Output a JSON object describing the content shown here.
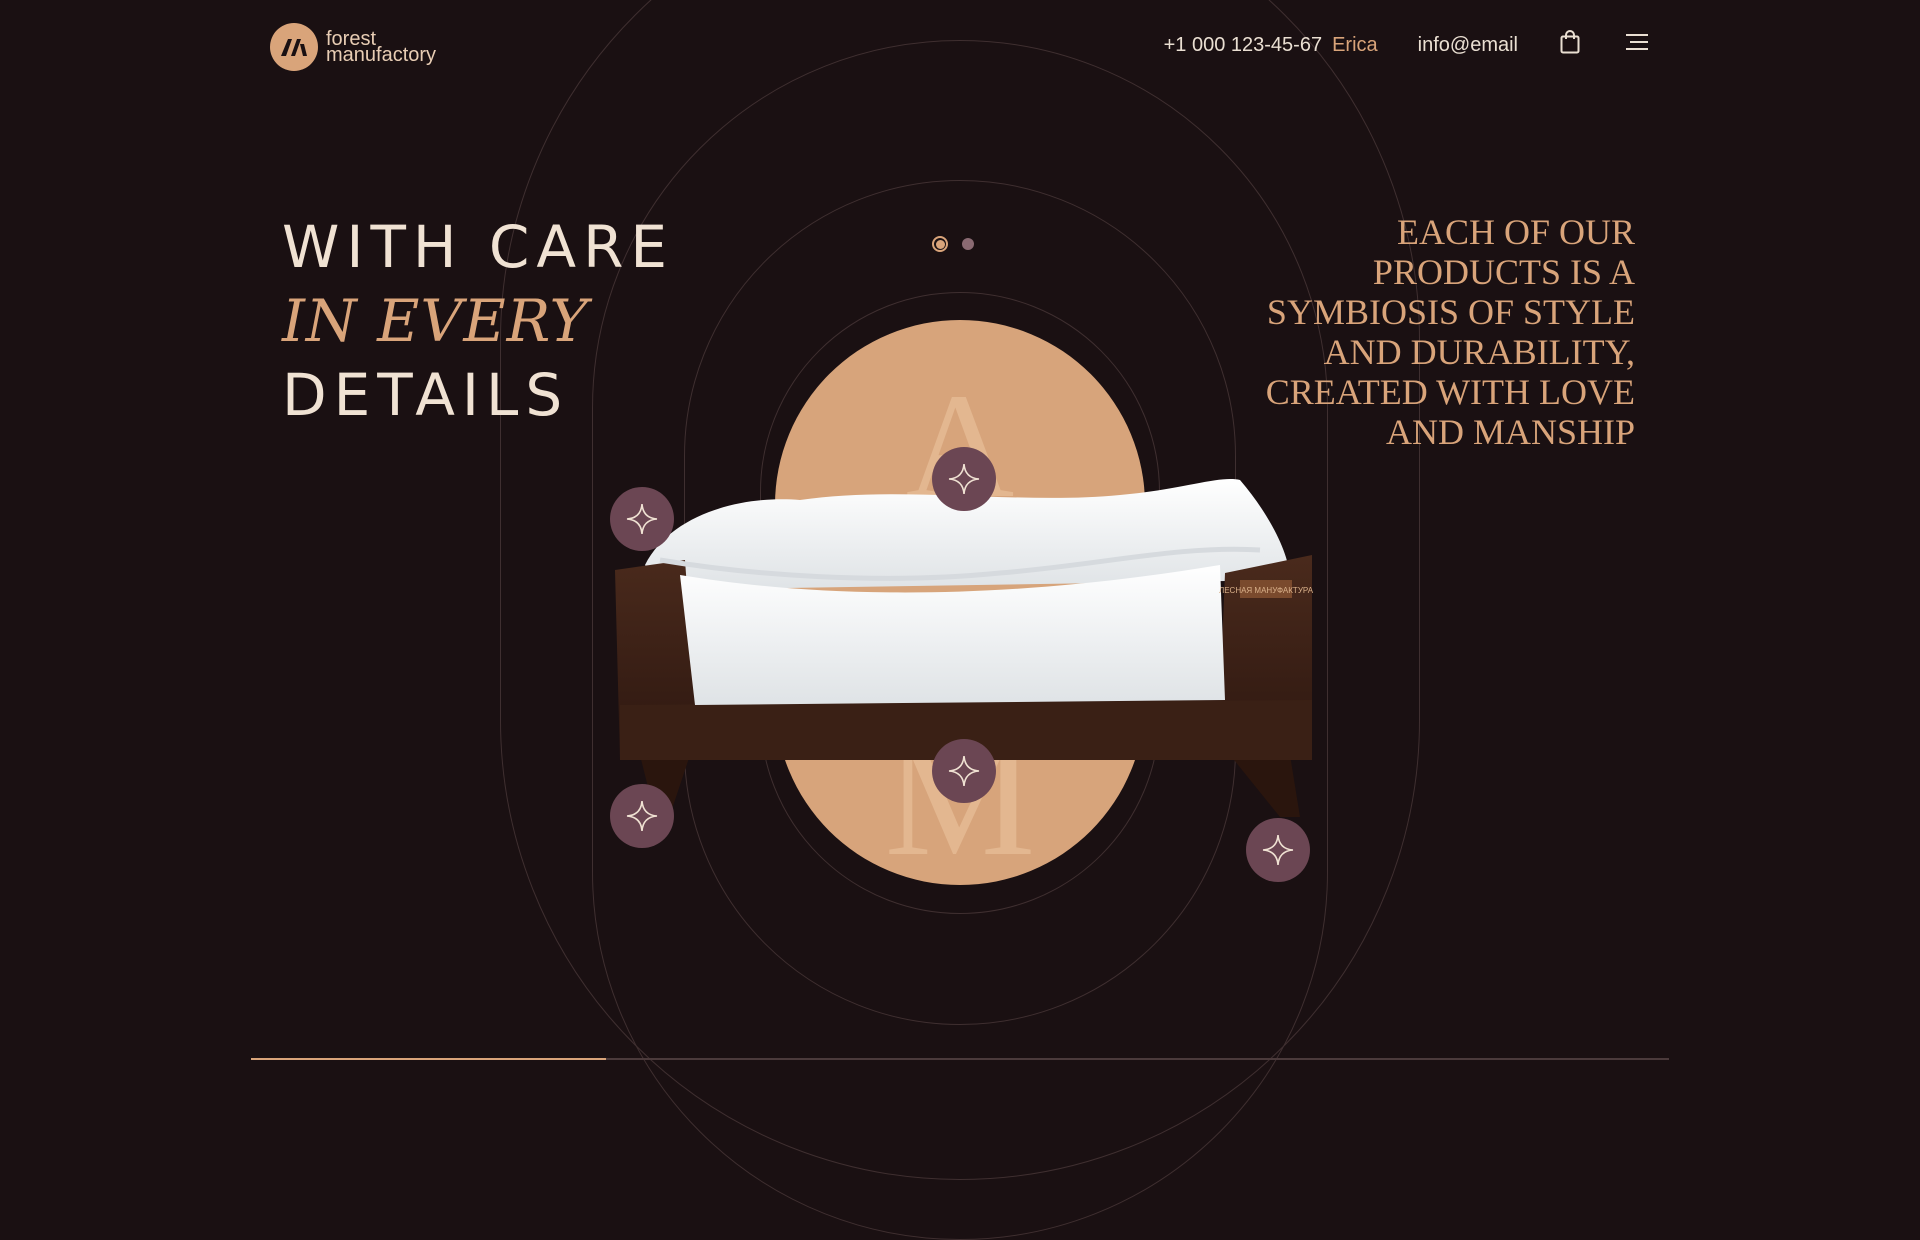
{
  "brand": {
    "line1": "forest",
    "line2": "manufactory"
  },
  "header": {
    "phone": "+1 000 123-45-67",
    "phone_name": "Erica",
    "email": "info@email"
  },
  "hero": {
    "line1": "WITH CARE",
    "line2": "IN EVERY",
    "line3": "DETAILS",
    "tagline": "EACH OF OUR PRODUCTS IS A SYMBIOSIS OF STYLE AND DURABILITY, CREATED WITH LOVE AND MANSHIP",
    "monogram_top": "A",
    "monogram_bottom": "M",
    "bed_label": "ЛЕСНАЯ МАНУФАКТУРА"
  },
  "slider": {
    "slides": 2,
    "active": 1
  },
  "progress": {
    "fraction": 0.25
  },
  "colors": {
    "background": "#1a1012",
    "accent": "#d9a47a",
    "hotspot": "#6b4653",
    "text_light": "#f0e2d3"
  },
  "icons": [
    "logo-mark-icon",
    "shopping-bag-icon",
    "menu-icon",
    "sparkle-icon"
  ]
}
